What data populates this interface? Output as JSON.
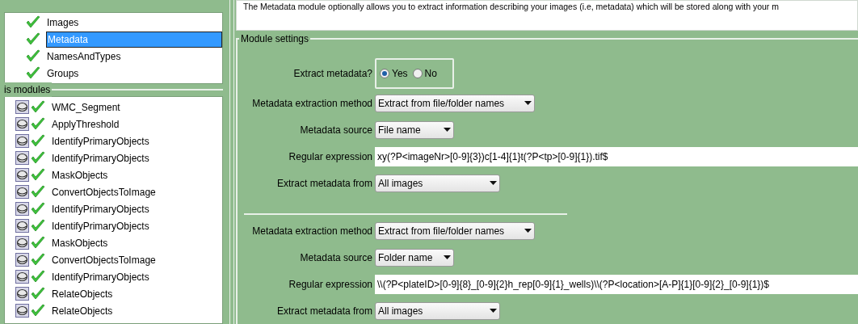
{
  "input_modules": {
    "items": [
      {
        "name": "Images",
        "selected": false
      },
      {
        "name": "Metadata",
        "selected": true
      },
      {
        "name": "NamesAndTypes",
        "selected": false
      },
      {
        "name": "Groups",
        "selected": false
      }
    ]
  },
  "analysis_modules": {
    "label": "is modules",
    "items": [
      {
        "name": "WMC_Segment"
      },
      {
        "name": "ApplyThreshold"
      },
      {
        "name": "IdentifyPrimaryObjects"
      },
      {
        "name": "IdentifyPrimaryObjects"
      },
      {
        "name": "MaskObjects"
      },
      {
        "name": "ConvertObjectsToImage"
      },
      {
        "name": "IdentifyPrimaryObjects"
      },
      {
        "name": "IdentifyPrimaryObjects"
      },
      {
        "name": "MaskObjects"
      },
      {
        "name": "ConvertObjectsToImage"
      },
      {
        "name": "IdentifyPrimaryObjects"
      },
      {
        "name": "RelateObjects"
      },
      {
        "name": "RelateObjects"
      }
    ]
  },
  "description": "The Metadata module optionally allows you to extract information describing your images (i.e, metadata) which will be stored along with your m",
  "module_settings": {
    "label": "Module settings",
    "extract_metadata": {
      "label": "Extract metadata?",
      "options": [
        {
          "label": "Yes",
          "selected": true
        },
        {
          "label": "No",
          "selected": false
        }
      ]
    },
    "groups": [
      {
        "rows": [
          {
            "kind": "dropdown",
            "label": "Metadata extraction method",
            "value": "Extract from file/folder names"
          },
          {
            "kind": "dropdown",
            "label": "Metadata source",
            "value": "File name"
          },
          {
            "kind": "text",
            "label": "Regular expression",
            "value": "xy(?P<imageNr>[0-9]{3})c[1-4]{1}t(?P<tp>[0-9]{1}).tif$"
          },
          {
            "kind": "dropdown",
            "label": "Extract metadata from",
            "value": "All images"
          }
        ]
      },
      {
        "rows": [
          {
            "kind": "dropdown",
            "label": "Metadata extraction method",
            "value": "Extract from file/folder names"
          },
          {
            "kind": "dropdown",
            "label": "Metadata source",
            "value": "Folder name"
          },
          {
            "kind": "text",
            "label": "Regular expression",
            "value": "\\\\(?P<plateID>[0-9]{8}_[0-9]{2}h_rep[0-9]{1}_wells)\\\\(?P<location>[A-P]{1}[0-9]{2}_[0-9]{1})$"
          },
          {
            "kind": "dropdown",
            "label": "Extract metadata from",
            "value": "All images"
          }
        ]
      }
    ]
  }
}
